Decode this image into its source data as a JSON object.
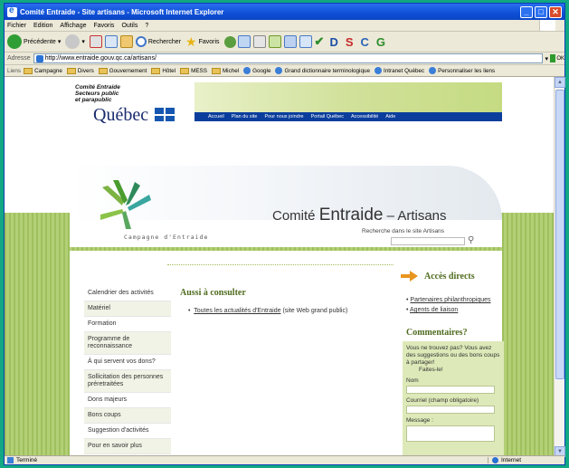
{
  "window": {
    "title": "Comité Entraide - Site artisans - Microsoft Internet Explorer",
    "controls": {
      "minimize": "_",
      "maximize": "□",
      "close": "✕"
    }
  },
  "menu": [
    "Fichier",
    "Edition",
    "Affichage",
    "Favoris",
    "Outils",
    "?"
  ],
  "toolbar": {
    "back": "Précédente",
    "search": "Rechercher",
    "favorites": "Favoris",
    "letters": [
      "D",
      "S",
      "C",
      "G"
    ]
  },
  "address": {
    "label": "Adresse",
    "url": "http://www.entraide.gouv.qc.ca/artisans/",
    "go": "OK"
  },
  "links": {
    "label": "Liens",
    "items": [
      "Campagne",
      "Divers",
      "Gouvernement",
      "Hôtel",
      "MESS",
      "Michel",
      "Google",
      "Grand dictionnaire terminologique",
      "Intranet Québec",
      "Personnaliser les liens"
    ]
  },
  "page": {
    "org_label": [
      "Comité Entraide",
      "Secteurs public",
      "et parapublic"
    ],
    "quebec": "Québec",
    "nav": [
      "Accueil",
      "Plan du site",
      "Pour nous joindre",
      "Portail Québec",
      "Accessibilité",
      "Aide"
    ],
    "site_title_prefix": "Comité",
    "site_title_big": "Entraide",
    "site_title_suffix": "– Artisans",
    "search_hint": "Recherche dans le site Artisans",
    "campagne": "Campagne d'Entraide",
    "sidebar": [
      "Calendrier des activités",
      "Matériel",
      "Formation",
      "Programme de reconnaissance",
      "À qui servent vos dons?",
      "Sollicitation des personnes préretraitées",
      "Dons majeurs",
      "Bons coups",
      "Suggestion d'activités",
      "Pour en savoir plus"
    ],
    "consult_heading": "Aussi à consulter",
    "consult_link": "Toutes les actualités d'Entraide",
    "consult_note": "(site Web grand public)",
    "acces_heading": "Accès directs",
    "acces_links": [
      "Partenaires philanthropiques",
      "Agents de liaison"
    ],
    "comments_heading": "Commentaires?",
    "comments_text": "Vous ne trouvez pas? Vous avez des suggestions ou des bons coups à partager!",
    "comments_cta": "Faites-le!",
    "form_name": "Nom",
    "form_email": "Courriel (champ obligatoire)",
    "form_message": "Message :"
  },
  "status": {
    "text": "Terminé",
    "zone": "Internet"
  }
}
